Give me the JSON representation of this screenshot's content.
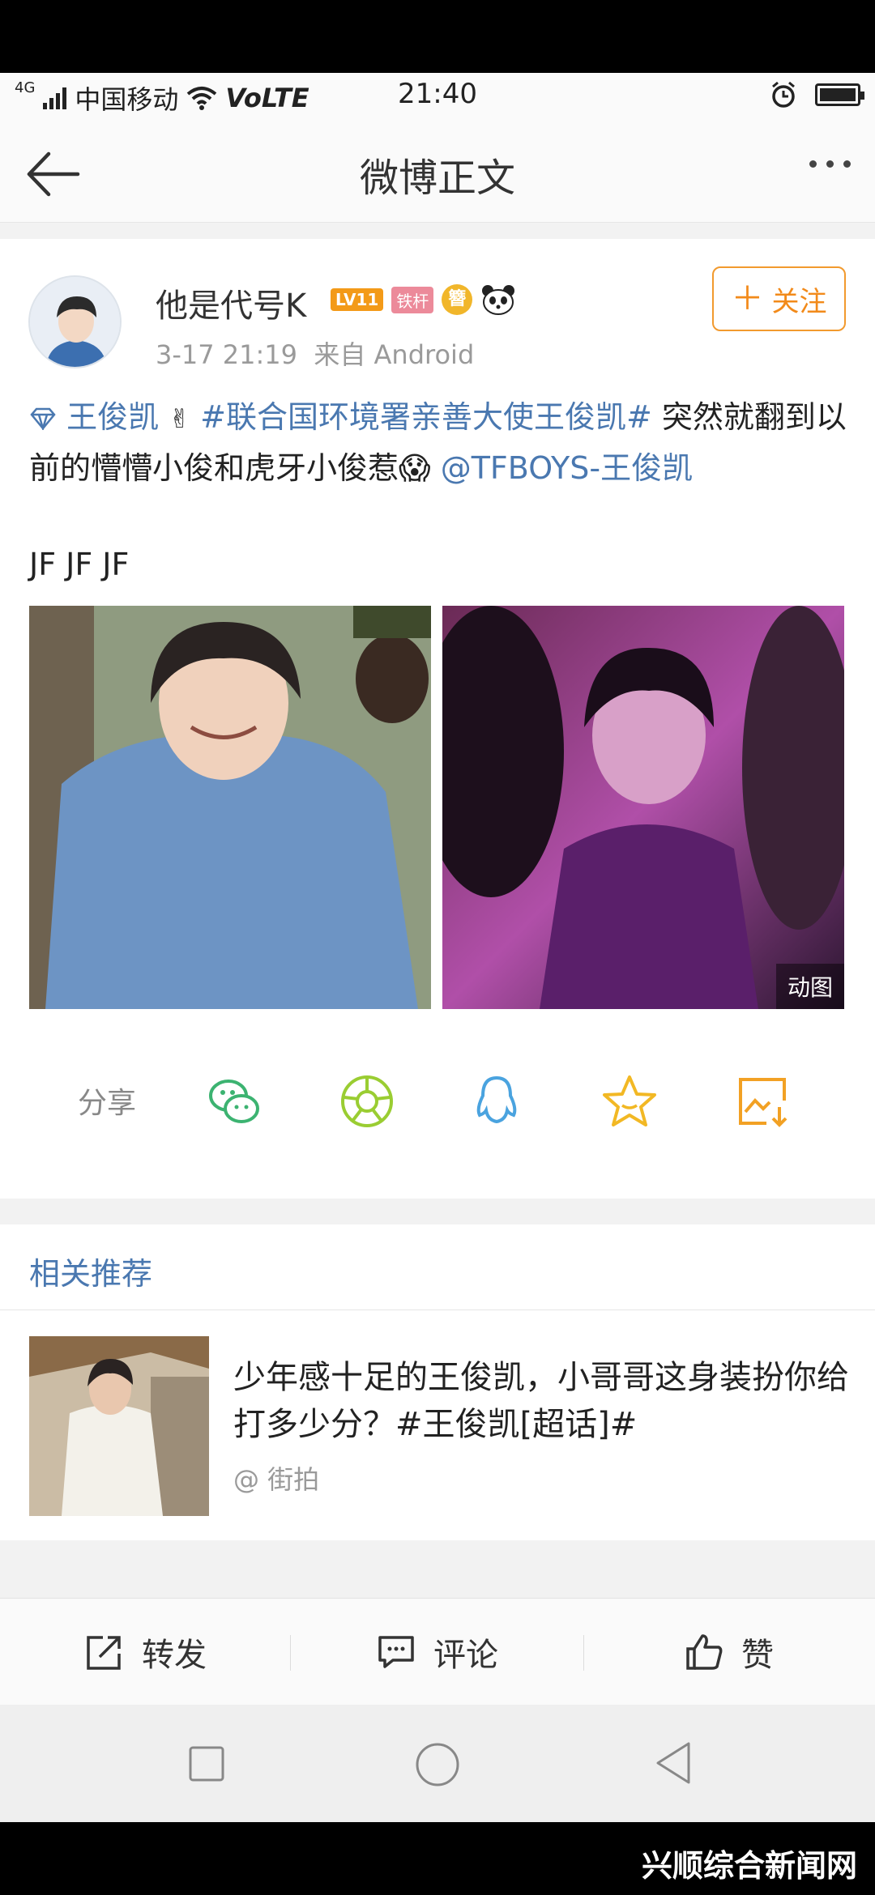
{
  "status": {
    "carrier": "中国移动",
    "net_type": "4G",
    "volte": "VoLTE",
    "time": "21:40"
  },
  "nav": {
    "title": "微博正文"
  },
  "post": {
    "username": "他是代号K",
    "badge_level": "LV11",
    "badge_iron": "铁杆",
    "badge_circle": "簪",
    "meta": "3-17 21:19  来自 Android",
    "follow_label": "关注",
    "text_tag1": "王俊凯",
    "text_tag2": "#联合国环境署亲善大使王俊凯#",
    "text_body": " 突然就翻到以前的懵懵小俊和虎牙小俊惹",
    "text_mention": " @TFBOYS-王俊凯",
    "text_jf": "JF JF JF",
    "gif_label": "动图",
    "share_label": "分享"
  },
  "related": {
    "title": "相关推荐",
    "item_text": "少年感十足的王俊凯，小哥哥这身装扮你给打多少分？#王俊凯[超话]#",
    "item_source": "@ 街拍"
  },
  "actions": {
    "repost": "转发",
    "comment": "评论",
    "like": "赞"
  },
  "watermark": "兴顺综合新闻网",
  "colors": {
    "accent_orange": "#f28a1a",
    "link_blue": "#4a78b0"
  }
}
